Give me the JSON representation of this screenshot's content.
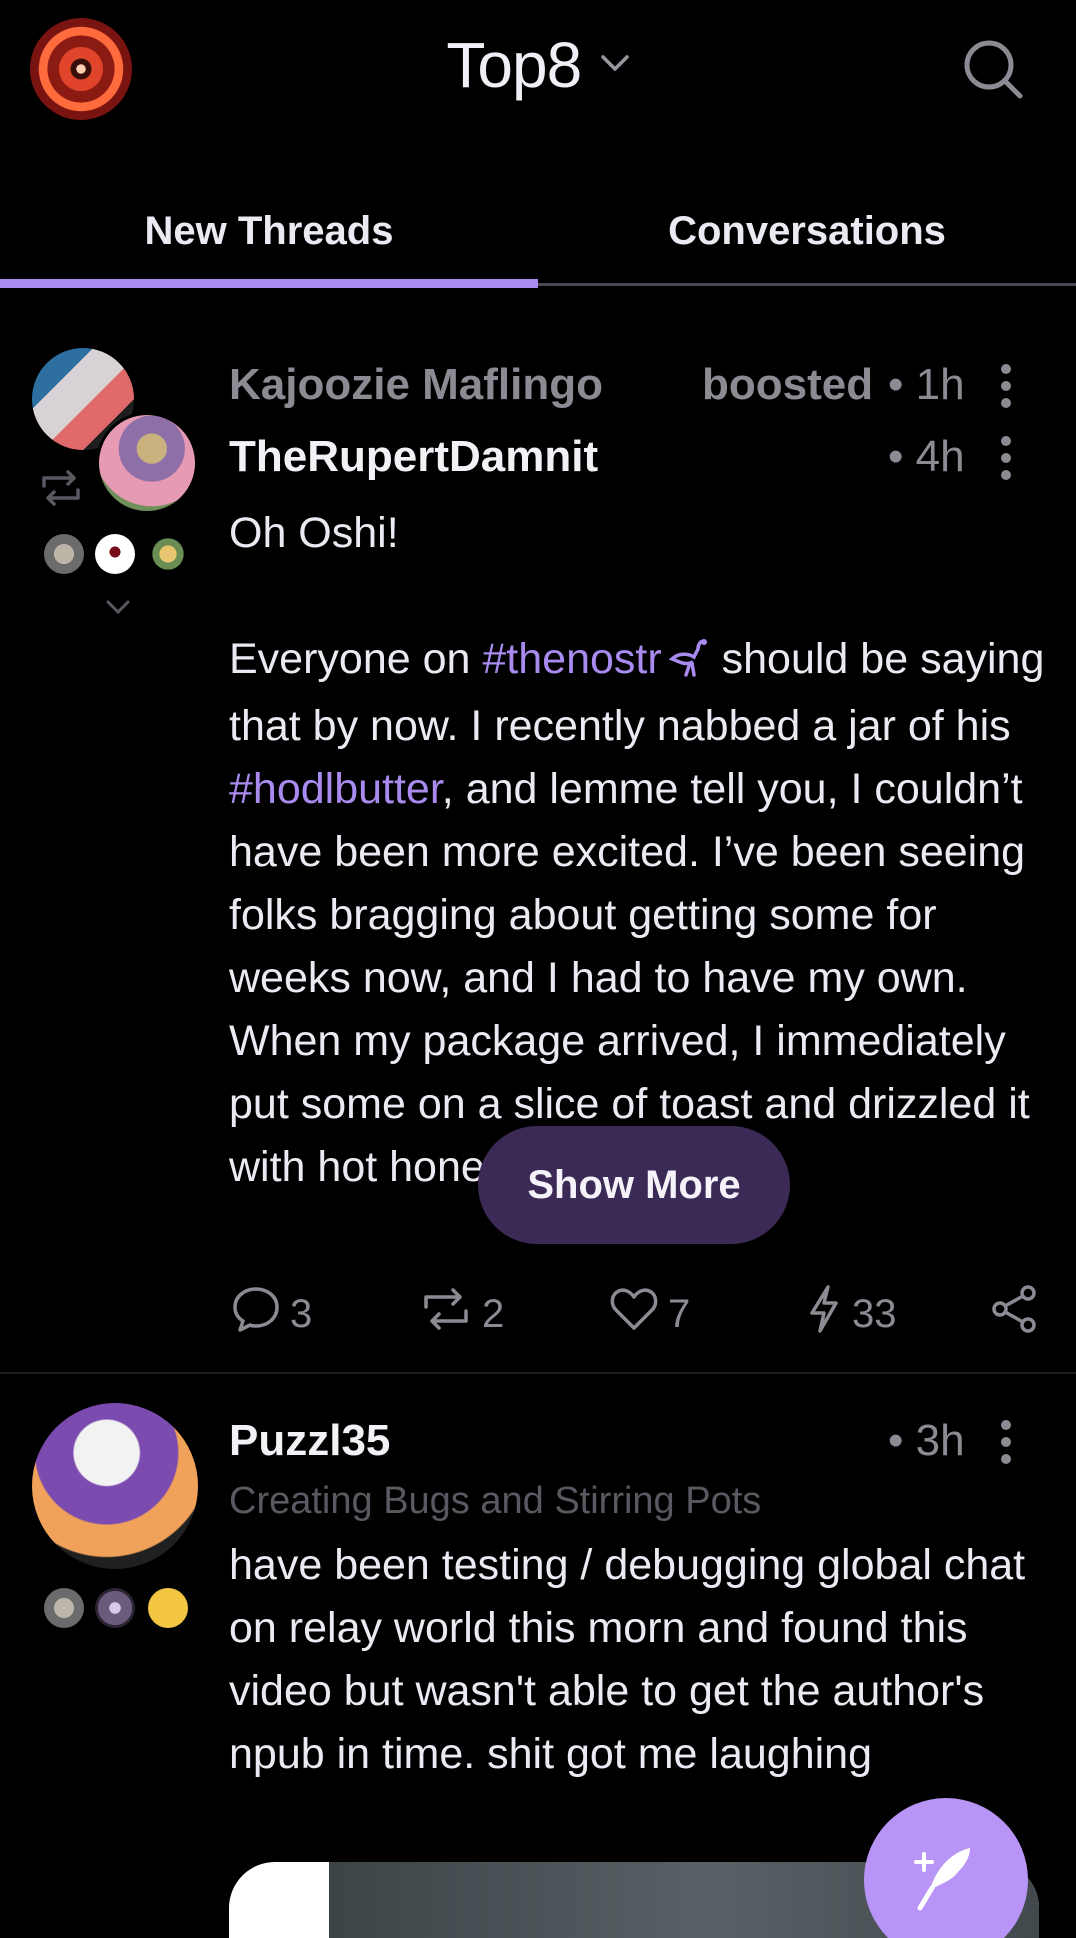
{
  "header": {
    "title": "Top8",
    "icons": {
      "profile": "user-avatar",
      "dropdown": "chevron-down-icon",
      "search": "search-icon"
    }
  },
  "tabs": [
    {
      "label": "New Threads",
      "active": true
    },
    {
      "label": "Conversations",
      "active": false
    }
  ],
  "posts": [
    {
      "booster": {
        "name": "Kajoozie Maflingo",
        "action": "boosted",
        "time": "• 1h"
      },
      "author": {
        "name": "TheRupertDamnit",
        "time": "• 4h"
      },
      "text": {
        "line1": "Oh Oshi!",
        "p2_start": "Everyone on ",
        "tag1": "#thenostr",
        "p2_mid": " should be saying that by now. I recently nabbed a jar of his ",
        "tag2": "#hodlbutter",
        "p2_end": ", and lemme tell you, I couldn’t have been more excited. I’ve been seeing folks bragging about getting some for weeks now, and I had to have my own. When my package arrived, I immediately put some on a slice of toast and drizzled it with hot honey."
      },
      "show_more": "Show More",
      "stats": {
        "replies": "3",
        "reposts": "2",
        "likes": "7",
        "zaps": "33"
      }
    },
    {
      "author": {
        "name": "Puzzl35",
        "time": "• 3h",
        "subtitle": "Creating Bugs and Stirring Pots"
      },
      "text": "have been testing / debugging global chat on relay world this morn and found this video but wasn't able to get the author's npub in time. shit got me laughing"
    }
  ],
  "fab": {
    "icon": "quill-plus-icon"
  },
  "colors": {
    "accent": "#a98bf0",
    "background": "#000000",
    "muted": "#8c8a92",
    "show_more_bg": "#3a2a55",
    "fab": "#b794f6"
  }
}
